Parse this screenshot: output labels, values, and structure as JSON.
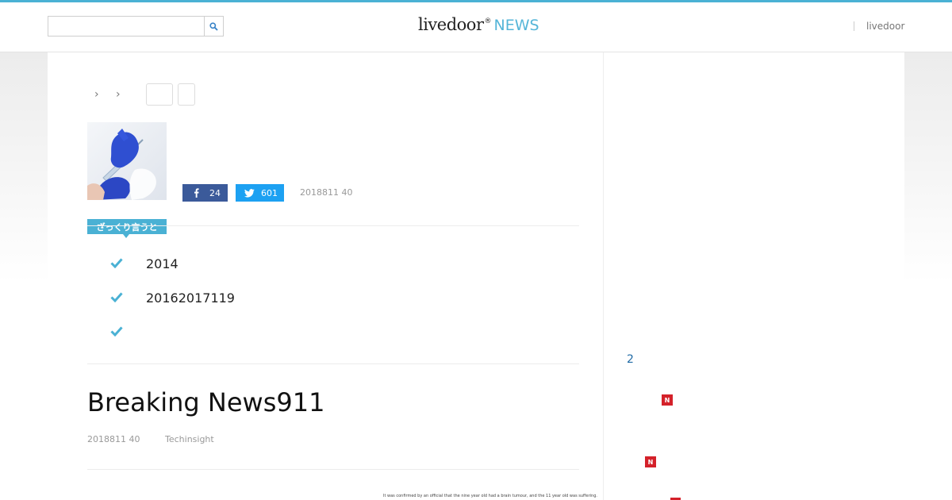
{
  "colors": {
    "accent": "#4ab1d4",
    "facebook": "#3b5a9a",
    "twitter": "#1da1f2",
    "badge": "#d4212a",
    "topline": "#4ab1d4"
  },
  "header": {
    "search": {
      "placeholder": "",
      "value": "",
      "icon": "search-icon"
    },
    "logo": {
      "main": "livedoor",
      "sup": "®",
      "news": "NEWS"
    },
    "link_label": "livedoor"
  },
  "article": {
    "share": {
      "facebook_count": "24",
      "twitter_count": "601"
    },
    "date": "2018811 40",
    "summary": {
      "label": "ざっくり言うと",
      "items": [
        "2014",
        "20162017119",
        ""
      ]
    },
    "title": "Breaking News911",
    "meta": {
      "date": "2018811 40",
      "source": "Techinsight"
    },
    "image_caption": "It was confirmed by an official that the nine year old had a brain tumour, and the 11 year old was suffering."
  },
  "sidebar": {
    "number": "2",
    "badge_label": "N"
  }
}
